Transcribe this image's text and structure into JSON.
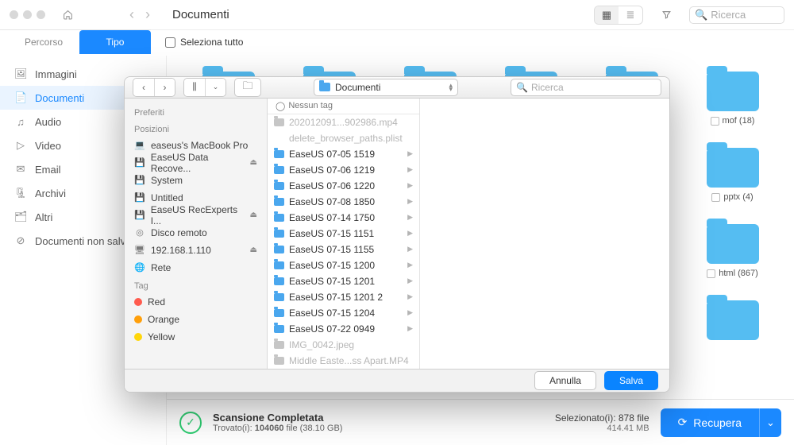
{
  "window": {
    "path_title": "Documenti",
    "search_placeholder": "Ricerca",
    "tabs": {
      "path": "Percorso",
      "type": "Tipo"
    },
    "select_all": "Seleziona tutto"
  },
  "categories": [
    {
      "id": "immagini",
      "label": "Immagini",
      "icon": "🖼"
    },
    {
      "id": "documenti",
      "label": "Documenti",
      "icon": "📄",
      "active": true
    },
    {
      "id": "audio",
      "label": "Audio",
      "icon": "♫"
    },
    {
      "id": "video",
      "label": "Video",
      "icon": "▷"
    },
    {
      "id": "email",
      "label": "Email",
      "icon": "✉"
    },
    {
      "id": "archivi",
      "label": "Archivi",
      "icon": "🗜"
    },
    {
      "id": "altri",
      "label": "Altri",
      "icon": "🗂"
    },
    {
      "id": "nonsalvati",
      "label": "Documenti non salvati",
      "icon": "⊘"
    }
  ],
  "grid_folders": [
    {
      "label": "mof (18)",
      "row": 1
    },
    {
      "label": "pptx (4)",
      "row": 2
    },
    {
      "label": "html (867)",
      "row": 3
    }
  ],
  "footer": {
    "scan_title": "Scansione Completata",
    "found_prefix": "Trovato(i): ",
    "found_count": "104060",
    "found_suffix": " file (38.10 GB)",
    "selected_line": "Selezionato(i): 878 file",
    "selected_size": "414.41 MB",
    "recover": "Recupera"
  },
  "sheet": {
    "location": "Documenti",
    "search_placeholder": "Ricerca",
    "col_header": "Nessun tag",
    "sidebar": {
      "favorites": "Preferiti",
      "locations": "Posizioni",
      "loc_items": [
        {
          "label": "easeus's MacBook Pro",
          "icon": "💻"
        },
        {
          "label": "EaseUS Data Recove...",
          "icon": "💾",
          "eject": true
        },
        {
          "label": "System",
          "icon": "💾"
        },
        {
          "label": "Untitled",
          "icon": "💾"
        },
        {
          "label": "EaseUS RecExperts I...",
          "icon": "💾",
          "eject": true
        },
        {
          "label": "Disco remoto",
          "icon": "◎"
        },
        {
          "label": "192.168.1.110",
          "icon": "🖥",
          "eject": true
        },
        {
          "label": "Rete",
          "icon": "🌐"
        }
      ],
      "tags_label": "Tag",
      "tags": [
        {
          "label": "Red",
          "color": "#ff5b4e"
        },
        {
          "label": "Orange",
          "color": "#ff9f0a"
        },
        {
          "label": "Yellow",
          "color": "#ffd60a"
        }
      ]
    },
    "files": [
      {
        "label": "202012091...902986.mp4",
        "dim": true,
        "gray": true
      },
      {
        "label": "delete_browser_paths.plist",
        "dim": true,
        "nofolder": true
      },
      {
        "label": "EaseUS 07-05 1519",
        "arrow": true
      },
      {
        "label": "EaseUS 07-06 1219",
        "arrow": true
      },
      {
        "label": "EaseUS 07-06 1220",
        "arrow": true
      },
      {
        "label": "EaseUS 07-08 1850",
        "arrow": true
      },
      {
        "label": "EaseUS 07-14 1750",
        "arrow": true
      },
      {
        "label": "EaseUS 07-15 1151",
        "arrow": true
      },
      {
        "label": "EaseUS 07-15 1155",
        "arrow": true
      },
      {
        "label": "EaseUS 07-15 1200",
        "arrow": true
      },
      {
        "label": "EaseUS 07-15 1201",
        "arrow": true
      },
      {
        "label": "EaseUS 07-15 1201 2",
        "arrow": true
      },
      {
        "label": "EaseUS 07-15 1204",
        "arrow": true
      },
      {
        "label": "EaseUS 07-22 0949",
        "arrow": true
      },
      {
        "label": "IMG_0042.jpeg",
        "dim": true,
        "gray": true
      },
      {
        "label": "Middle Easte...ss Apart.MP4",
        "dim": true,
        "gray": true
      }
    ],
    "buttons": {
      "cancel": "Annulla",
      "save": "Salva"
    }
  }
}
